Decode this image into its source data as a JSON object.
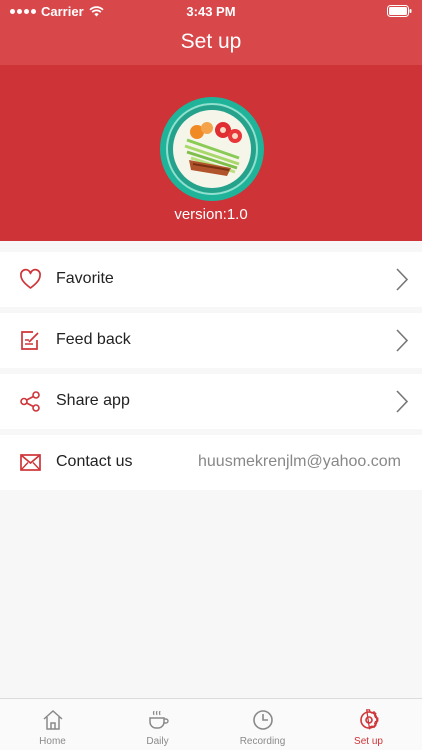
{
  "status_bar": {
    "carrier": "Carrier",
    "time": "3:43 PM"
  },
  "nav": {
    "title": "Set up"
  },
  "hero": {
    "version": "version:1.0"
  },
  "menu": {
    "items": [
      {
        "label": "Favorite",
        "icon": "heart-icon"
      },
      {
        "label": "Feed back",
        "icon": "edit-note-icon"
      },
      {
        "label": "Share app",
        "icon": "share-icon"
      },
      {
        "label": "Contact us",
        "icon": "mail-icon",
        "value": "huusmekrenjlm@yahoo.com"
      }
    ]
  },
  "tabbar": {
    "tabs": [
      {
        "label": "Home",
        "icon": "home-icon",
        "active": false
      },
      {
        "label": "Daily",
        "icon": "cup-icon",
        "active": false
      },
      {
        "label": "Recording",
        "icon": "clock-icon",
        "active": false
      },
      {
        "label": "Set up",
        "icon": "gear-icon",
        "active": true
      }
    ]
  },
  "colors": {
    "accent": "#cf3438",
    "header": "#d8484b",
    "hero": "#cd3337",
    "inactive": "#8a8a8a"
  }
}
